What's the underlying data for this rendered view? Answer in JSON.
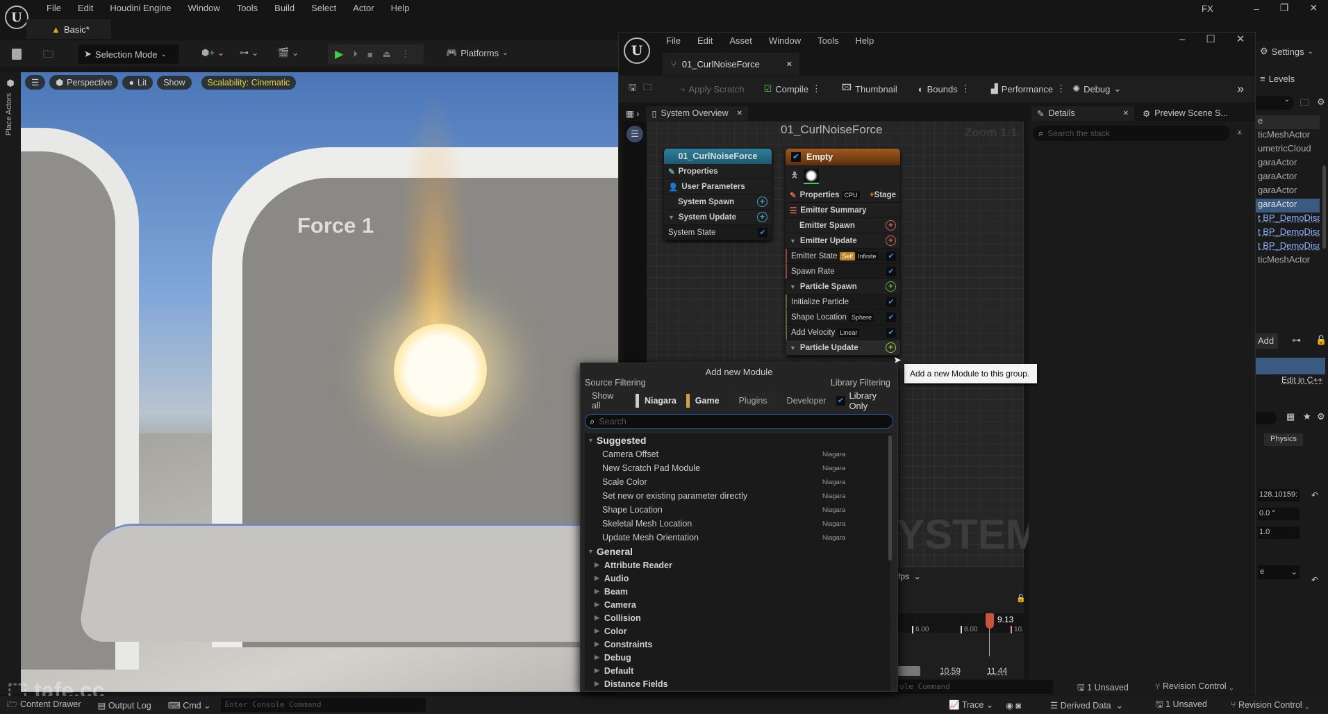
{
  "main_window": {
    "menu": [
      "File",
      "Edit",
      "Houdini Engine",
      "Window",
      "Tools",
      "Build",
      "Select",
      "Actor",
      "Help"
    ],
    "title_right": "FX",
    "tab": "Basic*",
    "toolbar": {
      "selection_mode": "Selection Mode",
      "platforms": "Platforms"
    },
    "viewport": {
      "perspective": "Perspective",
      "lit": "Lit",
      "show": "Show",
      "scalability": "Scalability: Cinematic",
      "scene_label": "Force 1"
    },
    "left_strip_label": "Place Actors",
    "watermark": "tafe.cc",
    "status_bar": {
      "content_drawer": "Content Drawer",
      "output_log": "Output Log",
      "cmd": "Cmd",
      "console_placeholder": "Enter Console Command",
      "trace": "Trace",
      "derived_data": "Derived Data",
      "unsaved": "1 Unsaved",
      "revision_control": "Revision Control"
    }
  },
  "right_panel": {
    "settings": "Settings",
    "levels": "Levels",
    "outliner_items": [
      {
        "label": "e",
        "link": false
      },
      {
        "label": "ticMeshActor",
        "link": false
      },
      {
        "label": "umetricCloud",
        "link": false
      },
      {
        "label": "garaActor",
        "link": false
      },
      {
        "label": "garaActor",
        "link": false
      },
      {
        "label": "garaActor",
        "link": false
      },
      {
        "label": "garaActor",
        "link": false,
        "selected": true
      },
      {
        "label": "t BP_DemoDisp",
        "link": true
      },
      {
        "label": "t BP_DemoDisp",
        "link": true
      },
      {
        "label": "t BP_DemoDisp",
        "link": true
      },
      {
        "label": "ticMeshActor",
        "link": false
      }
    ],
    "add": "Add",
    "edit_cpp": "Edit in C++",
    "physics": "Physics",
    "fields": [
      "128.10159:",
      "0.0 °",
      "1.0",
      "e"
    ]
  },
  "niagara": {
    "menu": [
      "File",
      "Edit",
      "Asset",
      "Window",
      "Tools",
      "Help"
    ],
    "tab": "01_CurlNoiseForce",
    "toolbar": {
      "apply_scratch": "Apply Scratch",
      "compile": "Compile",
      "thumbnail": "Thumbnail",
      "bounds": "Bounds",
      "performance": "Performance",
      "debug": "Debug"
    },
    "panels": {
      "system_overview": "System Overview",
      "details": "Details",
      "preview": "Preview Scene S..."
    },
    "graph": {
      "title": "01_CurlNoiseForce",
      "zoom": "Zoom 1:1",
      "watermark": "YSTEM"
    },
    "details_search_placeholder": "Search the stack",
    "system_node": {
      "title": "01_CurlNoiseForce",
      "rows": [
        "Properties",
        "User Parameters",
        "System Spawn",
        "System Update",
        "System State"
      ]
    },
    "emitter_node": {
      "title": "Empty",
      "properties": "Properties",
      "cpu": "CPU",
      "stage": "Stage",
      "summary": "Emitter Summary",
      "emitter_spawn": "Emitter Spawn",
      "emitter_update": "Emitter Update",
      "emitter_state": "Emitter State",
      "self": "Self",
      "infinite": "Infinite",
      "spawn_rate": "Spawn Rate",
      "particle_spawn": "Particle Spawn",
      "initialize_particle": "Initialize Particle",
      "shape_location": "Shape Location",
      "sphere": "Sphere",
      "add_velocity": "Add Velocity",
      "linear": "Linear",
      "particle_update": "Particle Update"
    },
    "tooltip": "Add a new Module to this group.",
    "timeline": {
      "fps": "fps",
      "ticks": [
        "6.00",
        "8.00",
        "10."
      ],
      "current": "9.13",
      "range_start": "10.59",
      "range_end": "11.44",
      "console_placeholder": "ole Command"
    },
    "status": {
      "unsaved": "1 Unsaved",
      "revision_control": "Revision Control"
    }
  },
  "add_module_popup": {
    "title": "Add new Module",
    "source_filtering": "Source Filtering",
    "library_filtering": "Library Filtering",
    "filters": [
      "Show all",
      "Niagara",
      "Game",
      "Plugins",
      "Developer"
    ],
    "library_only": "Library Only",
    "library_only_checked": true,
    "search_placeholder": "Search",
    "suggested_header": "Suggested",
    "suggested": [
      {
        "name": "Camera Offset",
        "source": "Niagara"
      },
      {
        "name": "New Scratch Pad Module",
        "source": "Niagara"
      },
      {
        "name": "Scale Color",
        "source": "Niagara"
      },
      {
        "name": "Set new or existing parameter directly",
        "source": "Niagara"
      },
      {
        "name": "Shape Location",
        "source": "Niagara"
      },
      {
        "name": "Skeletal Mesh Location",
        "source": "Niagara"
      },
      {
        "name": "Update Mesh Orientation",
        "source": "Niagara"
      }
    ],
    "general_header": "General",
    "categories": [
      "Attribute Reader",
      "Audio",
      "Beam",
      "Camera",
      "Collision",
      "Color",
      "Constraints",
      "Debug",
      "Default",
      "Distance Fields"
    ]
  }
}
